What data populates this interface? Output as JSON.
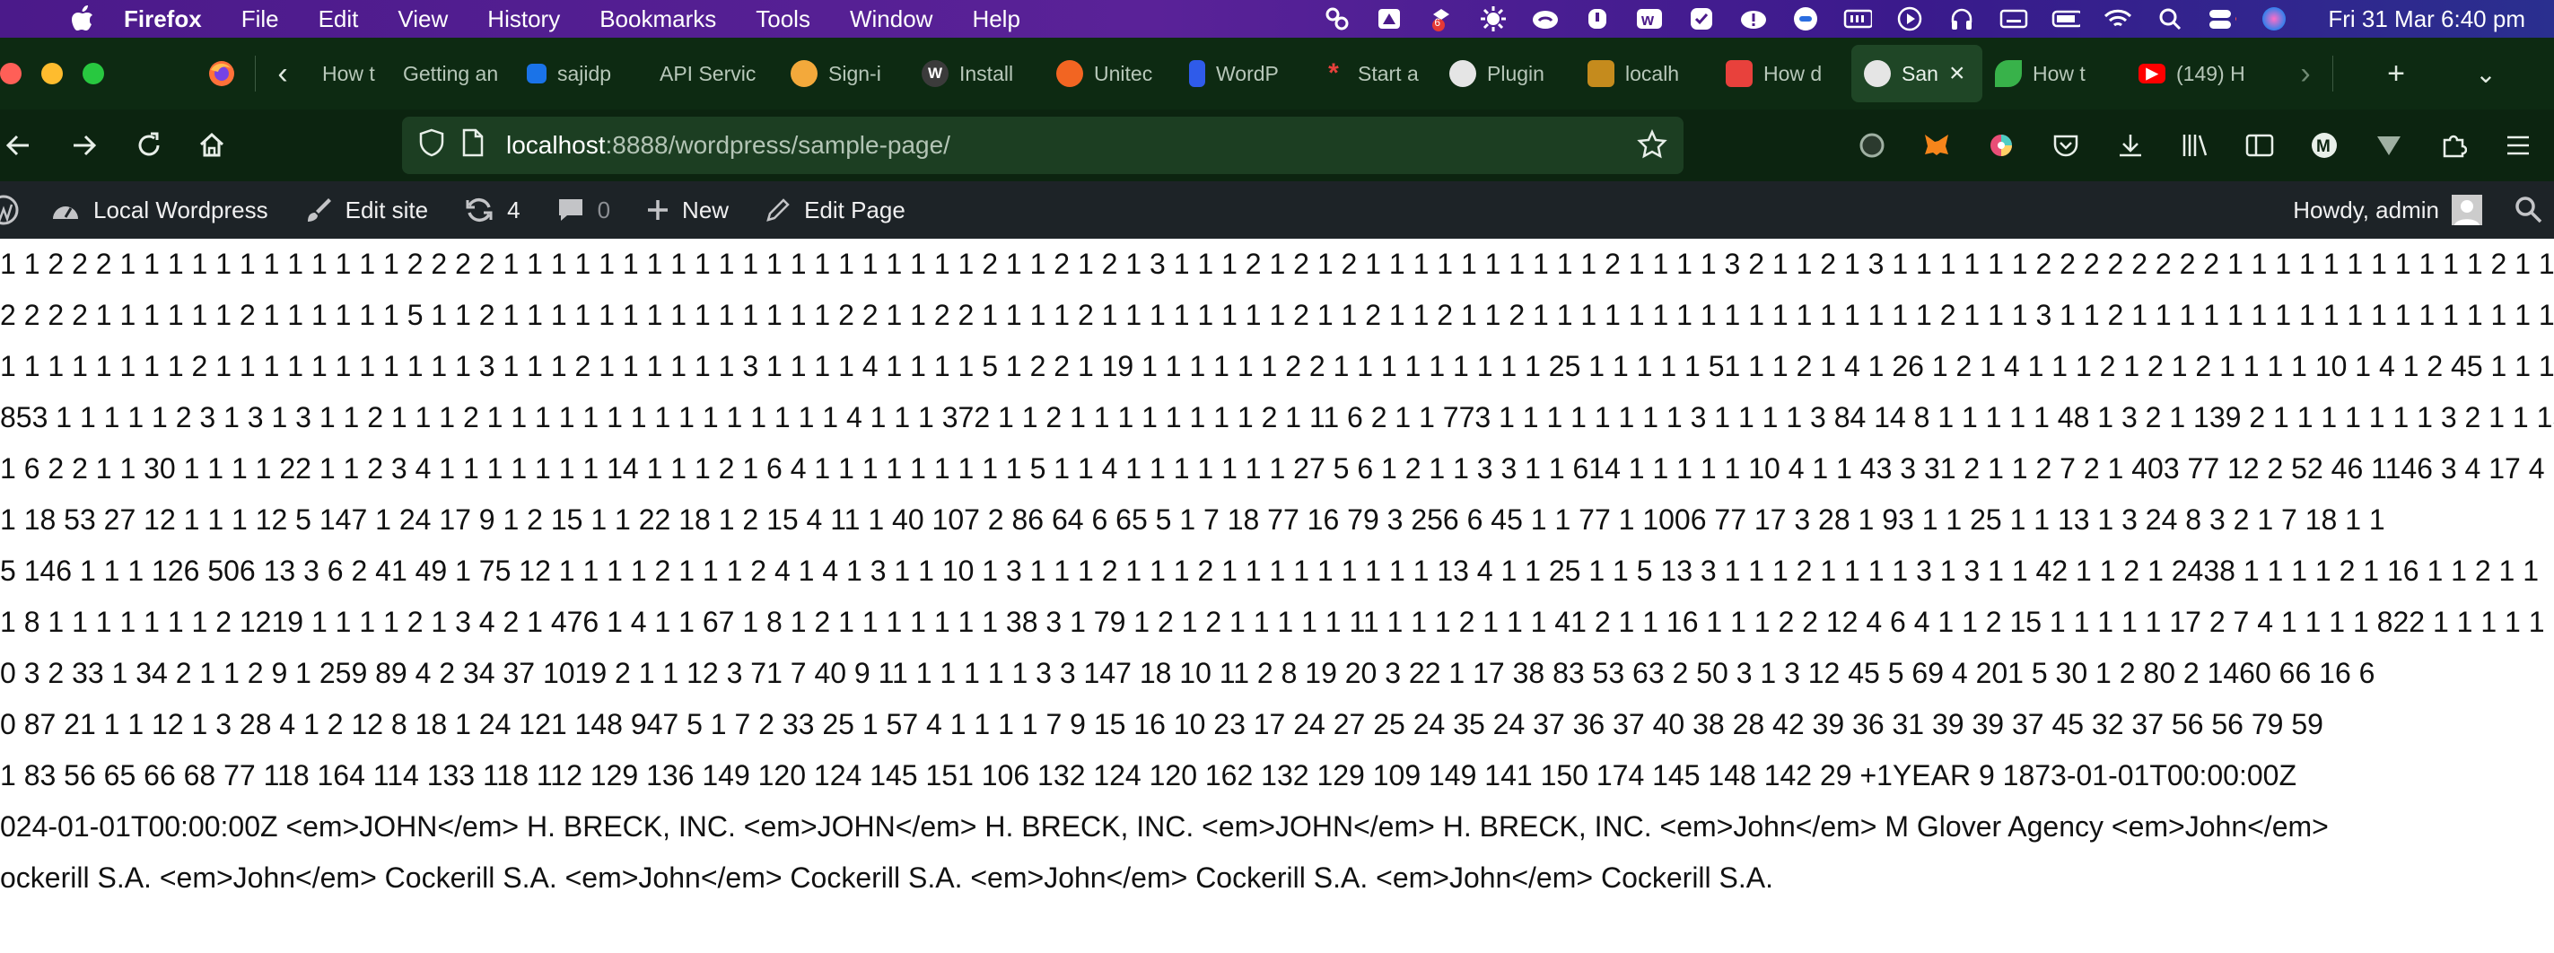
{
  "menubar": {
    "app": "Firefox",
    "items": [
      "File",
      "Edit",
      "View",
      "History",
      "Bookmarks",
      "Tools",
      "Window",
      "Help"
    ],
    "badge_count": "6",
    "clock": "Fri 31 Mar  6:40 pm"
  },
  "tabs": [
    {
      "title": "How t",
      "fav": "",
      "fav_color": "#2b2b2b"
    },
    {
      "title": "Getting an",
      "fav": "",
      "fav_color": "transparent"
    },
    {
      "title": "sajidp",
      "fav": "",
      "fav_color": "#1a73e8"
    },
    {
      "title": "API Servic",
      "fav": "",
      "fav_color": "transparent"
    },
    {
      "title": "Sign-i",
      "fav": "",
      "fav_color": "#f3a93b"
    },
    {
      "title": "Install",
      "fav": "W",
      "fav_color": "#3b3b3b"
    },
    {
      "title": "Unitec",
      "fav": "",
      "fav_color": "#f26522"
    },
    {
      "title": "WordP",
      "fav": "",
      "fav_color": "#2f5bea"
    },
    {
      "title": "Start a",
      "fav": "*",
      "fav_color": "transparent"
    },
    {
      "title": "Plugin",
      "fav": "",
      "fav_color": "#e5e5e5"
    },
    {
      "title": "localh",
      "fav": "",
      "fav_color": "#c58b1d"
    },
    {
      "title": "How d",
      "fav": "",
      "fav_color": "#e8413c"
    },
    {
      "title": "San",
      "fav": "",
      "fav_color": "#e5e5e5",
      "active": true
    },
    {
      "title": "How t",
      "fav": "",
      "fav_color": "#38b24a"
    },
    {
      "title": "(149) H",
      "fav": "",
      "fav_color": "#ff0000"
    }
  ],
  "url": {
    "host": "localhost",
    "path": ":8888/wordpress/sample-page/"
  },
  "adminbar": {
    "site": "Local Wordpress",
    "edit_site": "Edit site",
    "updates": "4",
    "comments": "0",
    "new": "New",
    "edit_page": "Edit Page",
    "howdy": "Howdy, admin"
  },
  "content": {
    "lines": [
      "1 1 2 2 2 1 1 1 1 1 1 1 1 1 1 1 1 2 2 2 2 1 1 1 1 1 1 1 1 1 1 1 1 1 1 1 1 1 1 1 1 2 1 1 2 1 2 1 3 1 1 1 2 1 2 1 2 1 1 1 1 1 1 1 1 1 1 2 1 1 1 1 3 2 1 1 2 1 3 1 1 1 1 1 1 2 2 2 2 2 2 2 2 1 1 1 1 1 1 1 1 1 1 1 2 1 1 1 1 1 1 1 1 1",
      "2 2 2 2 1 1 1 1 1 1 2 1 1 1 1 1 1 5 1 1 2 1 1 1 1 1 1 1 1 1 1 1 1 1 1 2 2 1 1 2 2 1 1 1 1 2 1 1 1 1 1 1 1 1 2 1 1 2 1 1 2 1 1 2 1 1 1 1 1 1 1 1 1 1 1 1 1 1 1 1 1 2 1 1 1 3 1 1 2 1 1 1 1 1 1 1 1 1 1 1 1 1 1 1 1 1 1 1 1 1 1 1 2 1 1 1",
      "1 1 1 1 1 1 1 1 2 1 1 1 1 1 1 1 1 1 1 1 3 1 1 1 2 1 1 1 1 1 1 3 1 1 1 1 4 1 1 1 1 5 1 2 2 1 19 1 1 1 1 1 1 2 2 1 1 1 1 1 1 1 1 1 25 1 1 1 1 1 51 1 1 2 1 4 1 26 1 2 1 4 1 1 1 2 1 2 1 2 1 1 1 1 10 1 4 1 2 45 1 1 1 1 1 1",
      "853 1 1 1 1 1 2 3 1 3 1 3 1 1 2 1 1 1 2 1 1 1 1 1 1 1 1 1 1 1 1 1 1 1 4 1 1 1 372 1 1 2 1 1 1 1 1 1 1 1 2 1 11 6 2 1 1 773 1 1 1 1 1 1 1 1 3 1 1 1 1 3 84 14 8 1 1 1 1 1 48 1 3 2 1 139 2 1 1 1 1 1 1 1 3 2 1 1 15 1 2 1 1",
      "1 6 2 2 1 1 30 1 1 1 1 22 1 1 2 3 4 1 1 1 1 1 1 1 14 1 1 1 2 1 6 4 1 1 1 1 1 1 1 1 1 5 1 1 4 1 1 1 1 1 1 1 27 5 6 1 2 1 1 3 3 1 1 614 1 1 1 1 1 10 4 1 1 43 3 31 2 1 1 2 7 2 1 403 77 12 2 52 46 1146 3 4 17 4 1",
      "1 18 53 27 12 1 1 1 12 5 147 1 24 17 9 1 2 15 1 1 22 18 1 2 15 4 11 1 40 107 2 86 64 6 65 5 1 7 18 77 16 79 3 256 6 45 1 1 77 1 1006 77 17 3 28 1 93 1 1 25 1 1 13 1 3 24 8 3 2 1 7 18 1 1",
      "5 146 1 1 1 126 506 13 3 6 2 41 49 1 75 12 1 1 1 1 2 1 1 1 2 4 1 4 1 3 1 1 10 1 3 1 1 1 2 1 1 1 2 1 1 1 1 1 1 1 1 1 13 4 1 1 25 1 1 5 13 3 1 1 1 2 1 1 1 1 3 1 3 1 1 42 1 1 2 1 2438 1 1 1 1 2 1 16 1 1 2 1 1",
      "1 8 1 1 1 1 1 1 1 2 1219 1 1 1 1 2 1 3 4 2 1 476 1 4 1 1 67 1 8 1 2 1 1 1 1 1 1 1 38 3 1 79 1 2 1 2 1 1 1 1 1 11 1 1 1 2 1 1 1 41 2 1 1 16 1 1 1 2 2 12 4 6 4 1 1 2 15 1 1 1 1 1 17 2 7 4 1 1 1 1 822 1 1 1 1 1",
      "0 3 2 33 1 34 2 1 1 2 9 1 259 89 4 2 34 37 1019 2 1 1 12 3 71 7 40 9 11 1 1 1 1 1 3 3 147 18 10 11 2 8 19 20 3 22 1 17 38 83 53 63 2 50 3 1 3 12 45 5 69 4 201 5 30 1 2 80 2 1460 66 16 6",
      "0 87 21 1 1 12 1 3 28 4 1 2 12 8 18 1 24 121 148 947 5 1 7 2 33 25 1 57 4 1 1 1 1 7 9 15 16 10 23 17 24 27 25 24 35 24 37 36 37 40 38 28 42 39 36 31 39 39 37 45 32 37 56 56 79 59",
      "1 83 56 65 66 68 77 118 164 114 133 118 112 129 136 149 120 124 145 151 106 132 124 120 162 132 129 109 149 141 150 174 145 148 142 29 +1YEAR 9 1873-01-01T00:00:00Z",
      "024-01-01T00:00:00Z <em>JOHN</em> H. BRECK, INC. <em>JOHN</em> H. BRECK, INC. <em>JOHN</em> H. BRECK, INC. <em>John</em> M Glover Agency <em>John</em>",
      "ockerill S.A. <em>John</em> Cockerill S.A. <em>John</em> Cockerill S.A. <em>John</em> Cockerill S.A. <em>John</em> Cockerill S.A."
    ]
  }
}
